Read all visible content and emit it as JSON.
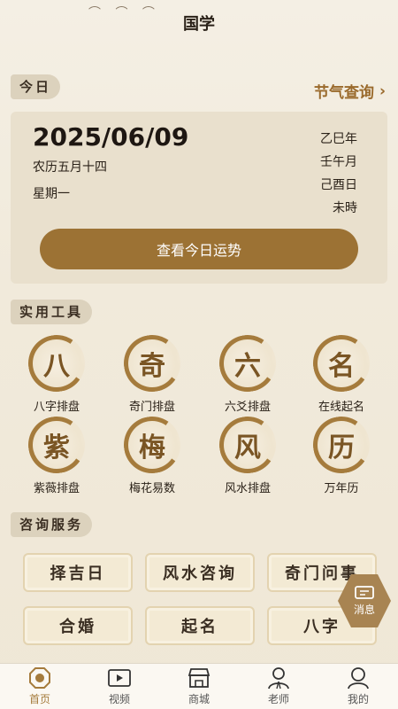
{
  "header": {
    "title": "国学"
  },
  "today": {
    "tag": "今日",
    "solar_terms_link": "节气查询",
    "date": "2025/06/09",
    "lunar": "农历五月十四",
    "weekday": "星期一",
    "ganzhi_year": "乙巳年",
    "ganzhi_month": "壬午月",
    "ganzhi_day": "己酉日",
    "ganzhi_hour": "未時",
    "fortune_button": "查看今日运势"
  },
  "tools": {
    "tag": "实用工具",
    "items": [
      {
        "glyph": "八",
        "label": "八字排盘"
      },
      {
        "glyph": "奇",
        "label": "奇门排盘"
      },
      {
        "glyph": "六",
        "label": "六爻排盘"
      },
      {
        "glyph": "名",
        "label": "在线起名"
      },
      {
        "glyph": "紫",
        "label": "紫薇排盘"
      },
      {
        "glyph": "梅",
        "label": "梅花易数"
      },
      {
        "glyph": "风",
        "label": "风水排盘"
      },
      {
        "glyph": "历",
        "label": "万年历"
      }
    ]
  },
  "consult": {
    "tag": "咨询服务",
    "items": [
      "择吉日",
      "风水咨询",
      "奇门问事",
      "合婚",
      "起名",
      "八字"
    ]
  },
  "fab": {
    "label": "消息"
  },
  "tabbar": {
    "items": [
      {
        "label": "首页",
        "icon": "bagua-icon"
      },
      {
        "label": "视频",
        "icon": "video-icon"
      },
      {
        "label": "商城",
        "icon": "shop-icon"
      },
      {
        "label": "老师",
        "icon": "teacher-icon"
      },
      {
        "label": "我的",
        "icon": "profile-icon"
      }
    ]
  },
  "colors": {
    "accent": "#9c7234",
    "background": "#f1eadb",
    "card": "#e9e0cd"
  }
}
